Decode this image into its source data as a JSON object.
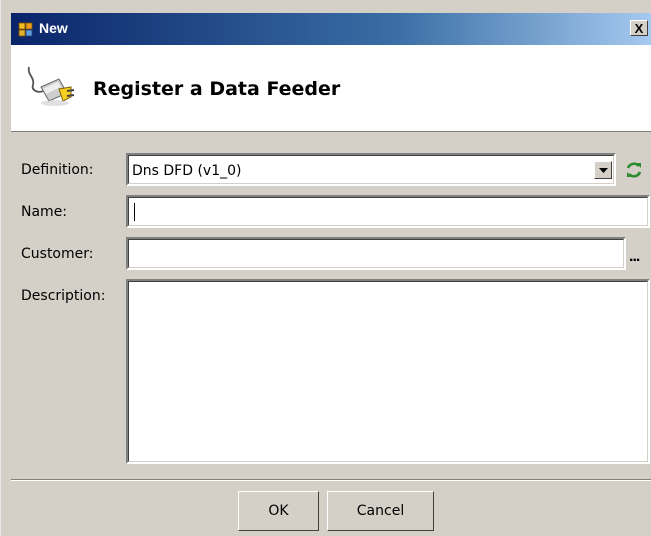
{
  "window": {
    "title": "New",
    "close_label": "X"
  },
  "header": {
    "title": "Register a Data Feeder"
  },
  "form": {
    "definition": {
      "label": "Definition:",
      "value": "Dns DFD (v1_0)"
    },
    "name": {
      "label": "Name:",
      "value": ""
    },
    "customer": {
      "label": "Customer:",
      "value": "",
      "browse_label": "..."
    },
    "description": {
      "label": "Description:",
      "value": ""
    }
  },
  "buttons": {
    "ok_label": "OK",
    "cancel_label": "Cancel"
  },
  "colors": {
    "titlebar_start": "#0a246a",
    "titlebar_end": "#a6caf0",
    "dialog_bg": "#d4d0c8",
    "refresh_green": "#2e8b2e"
  }
}
